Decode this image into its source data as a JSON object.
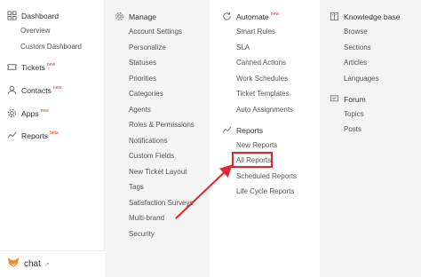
{
  "nav": {
    "dashboard": {
      "label": "Dashboard",
      "items": [
        "Overview",
        "Custom Dashboard"
      ]
    },
    "tickets": {
      "label": "Tickets",
      "badge": "new"
    },
    "contacts": {
      "label": "Contacts",
      "badge": "new"
    },
    "apps": {
      "label": "Apps",
      "badge": "new"
    },
    "reports": {
      "label": "Reports",
      "badge": "beta"
    }
  },
  "manage": {
    "label": "Manage",
    "items": [
      "Account Settings",
      "Personalize",
      "Statuses",
      "Priorities",
      "Categories",
      "Agents",
      "Roles & Permissions",
      "Notifications",
      "Custom Fields",
      "New Ticket Layout",
      "Tags",
      "Satisfaction Surveys",
      "Multi-brand",
      "Security"
    ]
  },
  "automate": {
    "label": "Automate",
    "badge": "new",
    "items": [
      "Smart Rules",
      "SLA",
      "Canned Actions",
      "Work Schedules",
      "Ticket Templates",
      "Auto Assignments"
    ]
  },
  "reports": {
    "label": "Reports",
    "items": [
      "New Reports",
      "All Reports",
      "Scheduled Reports",
      "Life Cycle Reports"
    ]
  },
  "knowledge_base": {
    "label": "Knowledge base",
    "items": [
      "Browse",
      "Sections",
      "Articles",
      "Languages"
    ]
  },
  "forum": {
    "label": "Forum",
    "items": [
      "Topics",
      "Posts"
    ]
  },
  "chat": {
    "label": "chat"
  },
  "colors": {
    "highlight": "#e1262b",
    "badge": "#d4382c",
    "brand": "#f28c28"
  }
}
